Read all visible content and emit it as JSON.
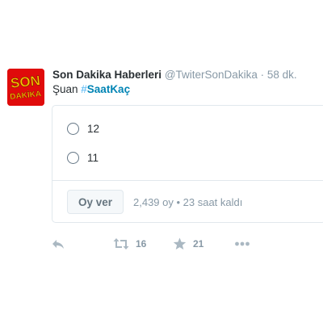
{
  "tweet": {
    "avatar_logo_text": [
      "SON",
      "DAKİKA"
    ],
    "fullname": "Son Dakika Haberleri",
    "username": "@TwiterSonDakika",
    "separator": "·",
    "time": "58 dk.",
    "text_prefix": "Şuan ",
    "hashtag_symbol": "#",
    "hashtag_text": "SaatKaç"
  },
  "poll": {
    "options": [
      {
        "label": "12"
      },
      {
        "label": "11"
      }
    ],
    "vote_button_label": "Oy ver",
    "meta": "2,439 oy • 23 saat kaldı"
  },
  "actions": {
    "reply_icon": "reply-icon",
    "retweet_icon": "retweet-icon",
    "retweet_count": "16",
    "like_icon": "star-icon",
    "like_count": "21",
    "more_icon": "more-icon"
  },
  "colors": {
    "avatar_bg": "#e00b0b",
    "avatar_text": "#f7c600",
    "link": "#0084b4",
    "muted": "#8899a6",
    "border": "#e1e8ed"
  }
}
